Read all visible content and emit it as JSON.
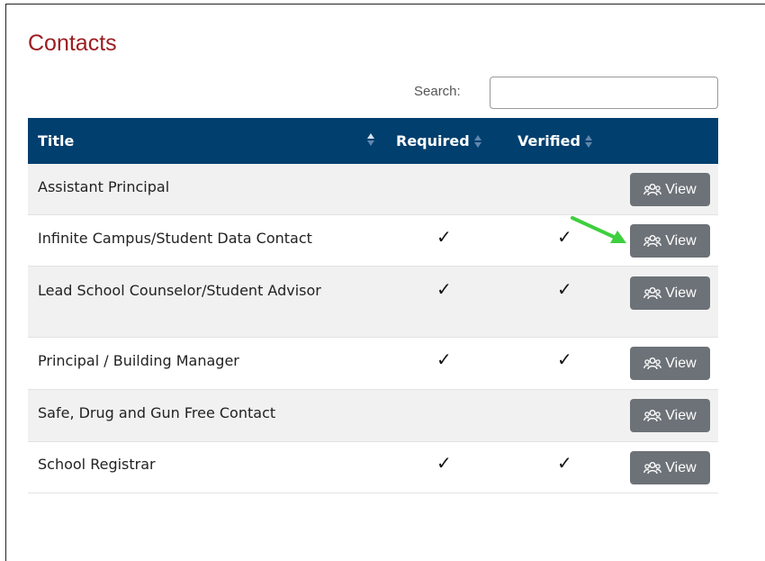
{
  "page": {
    "title": "Contacts"
  },
  "search": {
    "label": "Search:",
    "value": "",
    "placeholder": ""
  },
  "table": {
    "columns": {
      "title": "Title",
      "required": "Required",
      "verified": "Verified"
    },
    "sorted_column": "title",
    "sort_direction": "ascending",
    "view_label": "View",
    "check_mark": "✓",
    "rows": [
      {
        "title": "Assistant Principal",
        "required": false,
        "verified": false
      },
      {
        "title": "Infinite Campus/Student Data Contact",
        "required": true,
        "verified": true
      },
      {
        "title": "Lead School Counselor/Student Advisor",
        "required": true,
        "verified": true
      },
      {
        "title": "Principal / Building Manager",
        "required": true,
        "verified": true
      },
      {
        "title": "Safe, Drug and Gun Free Contact",
        "required": false,
        "verified": false
      },
      {
        "title": "School Registrar",
        "required": true,
        "verified": true
      }
    ]
  },
  "colors": {
    "heading": "#9b1c1f",
    "header_bg": "#003f6e",
    "button_bg": "#6d7278",
    "arrow": "#3ecf3e"
  },
  "icons": {
    "view_button": "users-icon",
    "annotation": "green-arrow-icon"
  }
}
